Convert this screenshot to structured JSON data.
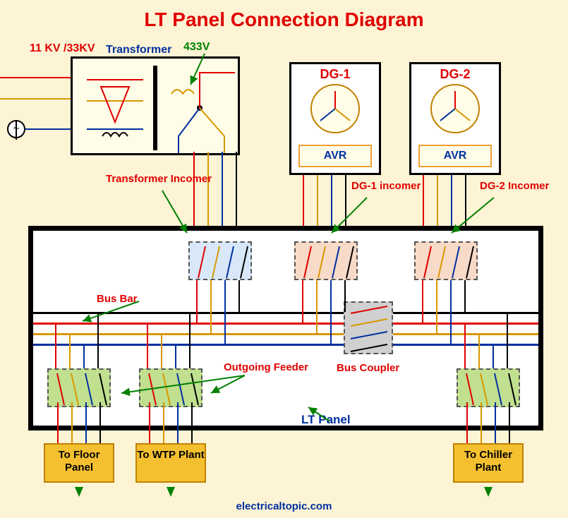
{
  "title": "LT Panel Connection Diagram",
  "labels": {
    "hv": "11 KV /33KV",
    "lv": "433V",
    "transformer": "Transformer",
    "dg1": "DG-1",
    "dg2": "DG-2",
    "avr": "AVR",
    "tf_incomer": "Transformer Incomer",
    "dg1_incomer": "DG-1 incomer",
    "dg2_incomer": "DG-2 Incomer",
    "busbar": "Bus Bar",
    "outgoing": "Outgoing Feeder",
    "coupler": "Bus Coupler",
    "lt_panel": "LT Panel"
  },
  "destinations": {
    "floor": "To Floor Panel",
    "wtp": "To WTP Plant",
    "chiller": "To Chiller Plant"
  },
  "footer": "electricaltopic.com",
  "phase_colors": {
    "r": "#e00000",
    "y": "#d89800",
    "b": "#0030a0",
    "n": "#000000"
  }
}
